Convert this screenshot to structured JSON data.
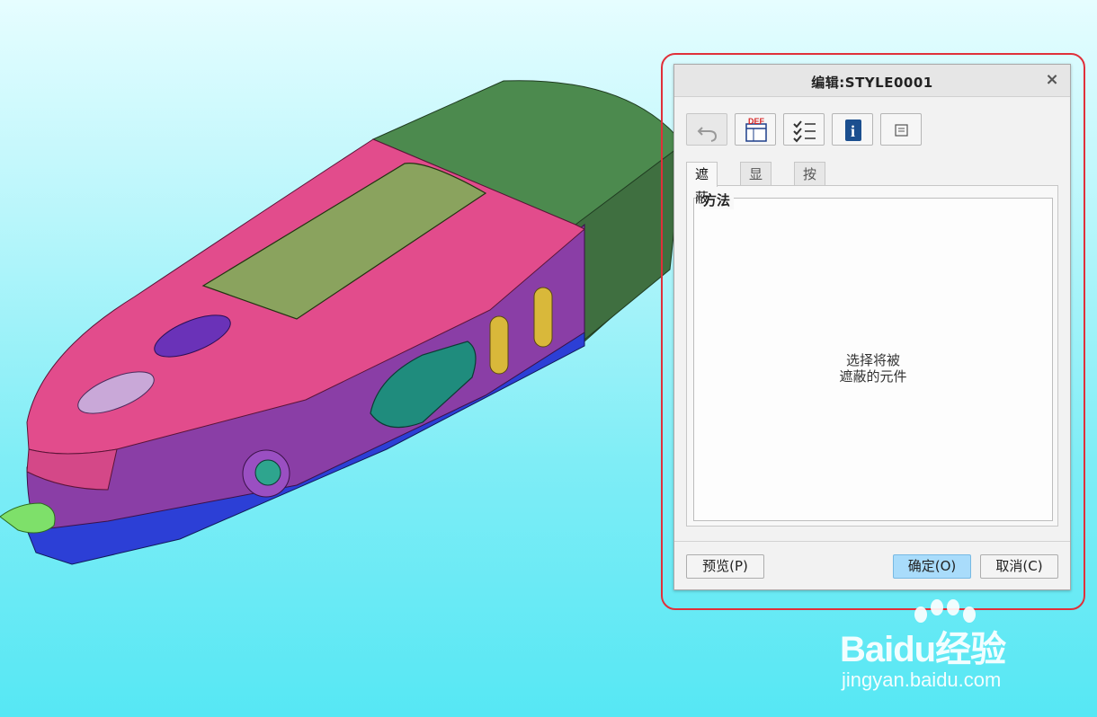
{
  "dialog": {
    "title": "编辑:STYLE0001",
    "close_label": "×",
    "toolbar": [
      {
        "icon": "undo-icon",
        "enabled": false
      },
      {
        "icon": "def-layer-icon",
        "label": "DEF",
        "enabled": true
      },
      {
        "icon": "checklist-icon",
        "enabled": true
      },
      {
        "icon": "info-icon",
        "label": "i",
        "enabled": true
      },
      {
        "icon": "properties-icon",
        "enabled": true
      }
    ],
    "tabs": [
      {
        "label": "遮蔽",
        "active": true
      },
      {
        "label": "显示",
        "active": false
      },
      {
        "label": "按显示",
        "active": false
      }
    ],
    "group_label": "方法",
    "collector_prompt": [
      "选择将被",
      "遮蔽的元件"
    ],
    "buttons": {
      "preview": "预览(P)",
      "ok": "确定(O)",
      "cancel": "取消(C)"
    }
  },
  "watermark": {
    "brand": "Baidu经验",
    "url": "jingyan.baidu.com"
  },
  "colors": {
    "accent_ring": "#e0303a",
    "ok_button": "#a9dcfb",
    "viewport_background": "#7eedf6"
  }
}
